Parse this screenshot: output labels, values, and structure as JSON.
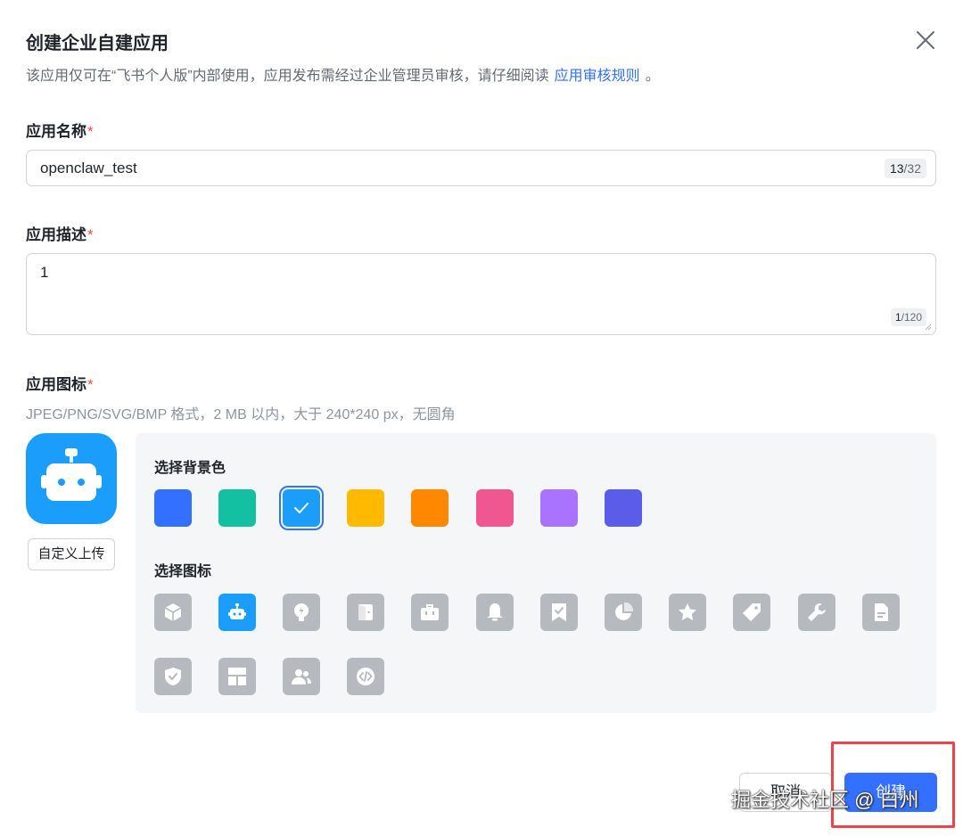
{
  "dialog": {
    "title": "创建企业自建应用",
    "subtitle_text": "该应用仅可在“飞书个人版”内部使用，应用发布需经过企业管理员审核，请仔细阅读",
    "subtitle_link": "应用审核规则",
    "subtitle_end": "。"
  },
  "form": {
    "name": {
      "label": "应用名称",
      "required_mark": "*",
      "value": "openclaw_test",
      "count_current": "13",
      "count_max": "/32"
    },
    "description": {
      "label": "应用描述",
      "required_mark": "*",
      "value": "1",
      "count_current": "1",
      "count_max": "/120"
    },
    "icon": {
      "label": "应用图标",
      "required_mark": "*",
      "hint": "JPEG/PNG/SVG/BMP 格式，2 MB 以内，大于 240*240 px，无圆角",
      "upload_label": "自定义上传",
      "preview_color": "#1b9dfb",
      "preview_icon": "robot-icon"
    }
  },
  "picker": {
    "bg_title": "选择背景色",
    "bg_colors": [
      "#3370ff",
      "#14c0a2",
      "#1b9dfb",
      "#ffba00",
      "#ff8800",
      "#f0568f",
      "#a973ff",
      "#5b5de8"
    ],
    "bg_selected_index": 2,
    "icon_title": "选择图标",
    "icons": [
      "box-icon",
      "robot-icon",
      "lightbulb-icon",
      "door-icon",
      "briefcase-icon",
      "bell-icon",
      "bookmark-check-icon",
      "pie-chart-icon",
      "star-icon",
      "tag-icon",
      "wrench-icon",
      "document-icon",
      "shield-check-icon",
      "layout-icon",
      "users-icon",
      "code-icon"
    ],
    "icon_selected": "robot-icon"
  },
  "footer": {
    "cancel_label": "取消",
    "create_label": "创建"
  },
  "watermark": "掘金技术社区 @ 白州",
  "colors": {
    "primary": "#3370ff",
    "highlight": "#f0424b",
    "required": "#f54a45"
  }
}
